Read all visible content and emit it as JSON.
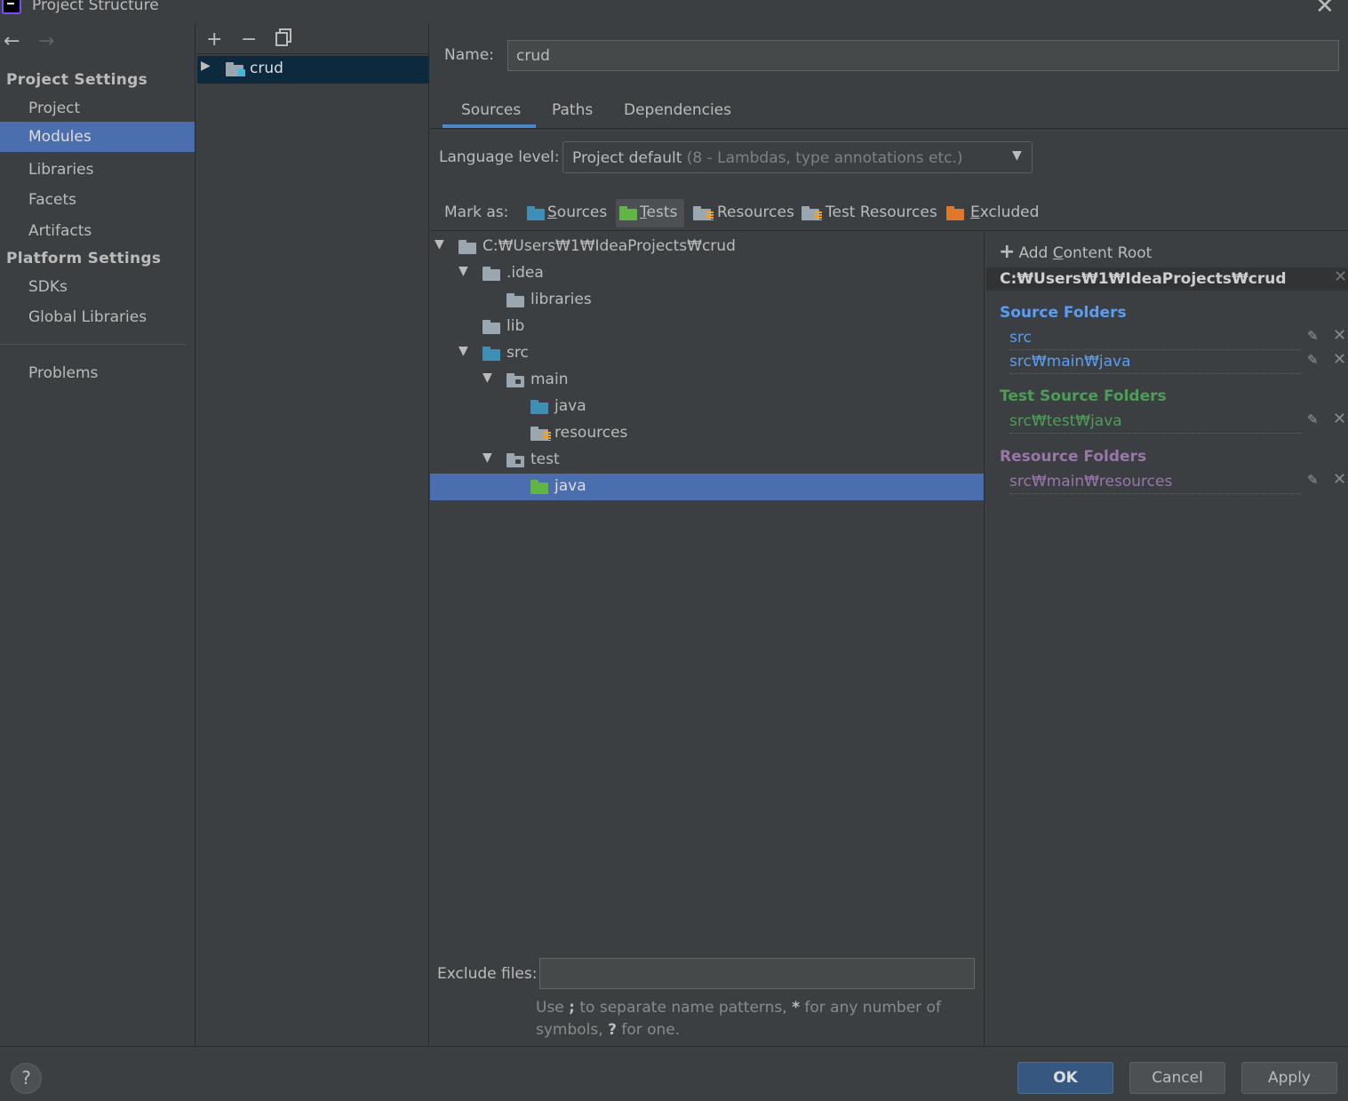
{
  "window": {
    "title": "Project Structure"
  },
  "nav": {
    "project_settings_header": "Project Settings",
    "project_items": [
      "Project",
      "Modules",
      "Libraries",
      "Facets",
      "Artifacts"
    ],
    "selected_item": "Modules",
    "platform_settings_header": "Platform Settings",
    "platform_items": [
      "SDKs",
      "Global Libraries"
    ],
    "problems": "Problems"
  },
  "modules": {
    "items": [
      {
        "name": "crud"
      }
    ]
  },
  "module_detail": {
    "name_label": "Name:",
    "name_value": "crud",
    "tabs": [
      "Sources",
      "Paths",
      "Dependencies"
    ],
    "active_tab": "Sources",
    "language_level_label": "Language level:",
    "language_level_value": "Project default",
    "language_level_hint": "(8 - Lambdas, type annotations etc.)",
    "mark_as_label": "Mark as:",
    "mark_as": {
      "sources": {
        "pre": "",
        "u": "S",
        "post": "ources"
      },
      "tests": {
        "pre": "",
        "u": "T",
        "post": "ests"
      },
      "resources": {
        "label": "Resources"
      },
      "test_resources": {
        "label": "Test Resources"
      },
      "excluded": {
        "pre": "",
        "u": "E",
        "post": "xcluded"
      }
    },
    "active_mark": "Tests",
    "tree": [
      {
        "label": "C:₩Users₩1₩IdeaProjects₩crud",
        "depth": 0,
        "expanded": true,
        "icon": "folder-grey-icon"
      },
      {
        "label": ".idea",
        "depth": 1,
        "expanded": true,
        "icon": "folder-grey-icon"
      },
      {
        "label": "libraries",
        "depth": 2,
        "expanded": null,
        "icon": "folder-grey-icon"
      },
      {
        "label": "lib",
        "depth": 1,
        "expanded": null,
        "icon": "folder-grey-icon"
      },
      {
        "label": "src",
        "depth": 1,
        "expanded": true,
        "icon": "folder-source-icon"
      },
      {
        "label": "main",
        "depth": 2,
        "expanded": true,
        "icon": "folder-package-icon"
      },
      {
        "label": "java",
        "depth": 3,
        "expanded": null,
        "icon": "folder-source-icon"
      },
      {
        "label": "resources",
        "depth": 3,
        "expanded": null,
        "icon": "folder-resources-icon"
      },
      {
        "label": "test",
        "depth": 2,
        "expanded": true,
        "icon": "folder-package-icon"
      },
      {
        "label": "java",
        "depth": 3,
        "expanded": null,
        "icon": "folder-test-icon",
        "selected": true
      }
    ],
    "exclude_files_label": "Exclude files:",
    "exclude_files_value": "",
    "exclude_hint_1": "Use",
    "exclude_hint_sep": ";",
    "exclude_hint_2": "to separate name patterns,",
    "exclude_hint_star": "*",
    "exclude_hint_3": "for any number of symbols,",
    "exclude_hint_q": "?",
    "exclude_hint_4": "for one."
  },
  "content_roots": {
    "add_root": {
      "pre": "Add ",
      "u": "C",
      "post": "ontent Root"
    },
    "root_path": "C:₩Users₩1₩IdeaProjects₩crud",
    "source_folders_title": "Source Folders",
    "source_folders": [
      "src",
      "src₩main₩java"
    ],
    "test_source_folders_title": "Test Source Folders",
    "test_source_folders": [
      "src₩test₩java"
    ],
    "resource_folders_title": "Resource Folders",
    "resource_folders": [
      "src₩main₩resources"
    ]
  },
  "buttons": {
    "help": "?",
    "ok": "OK",
    "cancel": "Cancel",
    "apply": "Apply"
  },
  "colors": {
    "selection": "#4b6eaf",
    "source": "#589df6",
    "test": "#4f9b59",
    "resource": "#9876aa",
    "ok_button": "#365880"
  }
}
